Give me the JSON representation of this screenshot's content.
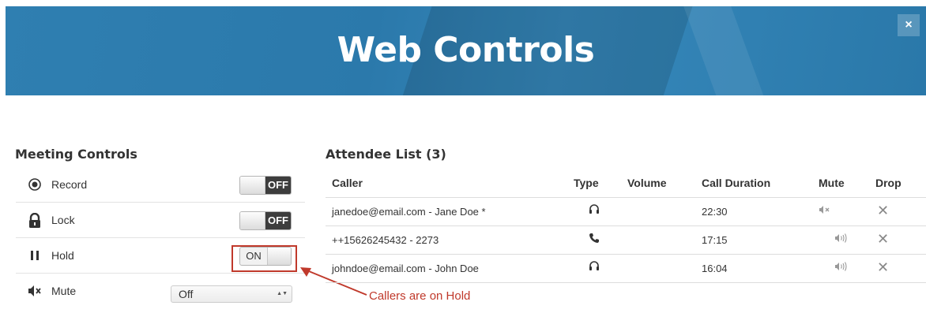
{
  "banner": {
    "title": "Web Controls",
    "close_label": "×"
  },
  "meeting_controls": {
    "title": "Meeting Controls",
    "rows": [
      {
        "label": "Record",
        "icon": "◉",
        "control": "toggle",
        "state": "OFF"
      },
      {
        "label": "Lock",
        "icon": "🔒",
        "control": "toggle",
        "state": "OFF"
      },
      {
        "label": "Hold",
        "icon": "❚❚",
        "control": "toggle",
        "state": "ON"
      },
      {
        "label": "Mute",
        "icon": "◀×",
        "control": "select",
        "value": "Off"
      }
    ]
  },
  "annotation": {
    "text": "Callers are on Hold",
    "color": "#c0392b"
  },
  "attendees": {
    "title": "Attendee List (3)",
    "columns": [
      "Caller",
      "Type",
      "Volume",
      "Call Duration",
      "Mute",
      "Drop"
    ],
    "rows": [
      {
        "caller": "janedoe@email.com - Jane Doe *",
        "type_icon": "headset-icon",
        "type_glyph": "🎧",
        "duration": "22:30",
        "mute_glyph": "◀×",
        "drop_glyph": "✕"
      },
      {
        "caller": "++15626245432 - 2273",
        "type_icon": "phone-icon",
        "type_glyph": "✆",
        "duration": "17:15",
        "mute_glyph": "◀)))",
        "drop_glyph": "✕"
      },
      {
        "caller": "johndoe@email.com - John Doe",
        "type_icon": "headset-icon",
        "type_glyph": "🎧",
        "duration": "16:04",
        "mute_glyph": "◀)))",
        "drop_glyph": "✕"
      }
    ]
  },
  "colors": {
    "banner": "#2f7fb1",
    "toggle_off": "#3d3d3d",
    "annotation": "#c0392b"
  }
}
